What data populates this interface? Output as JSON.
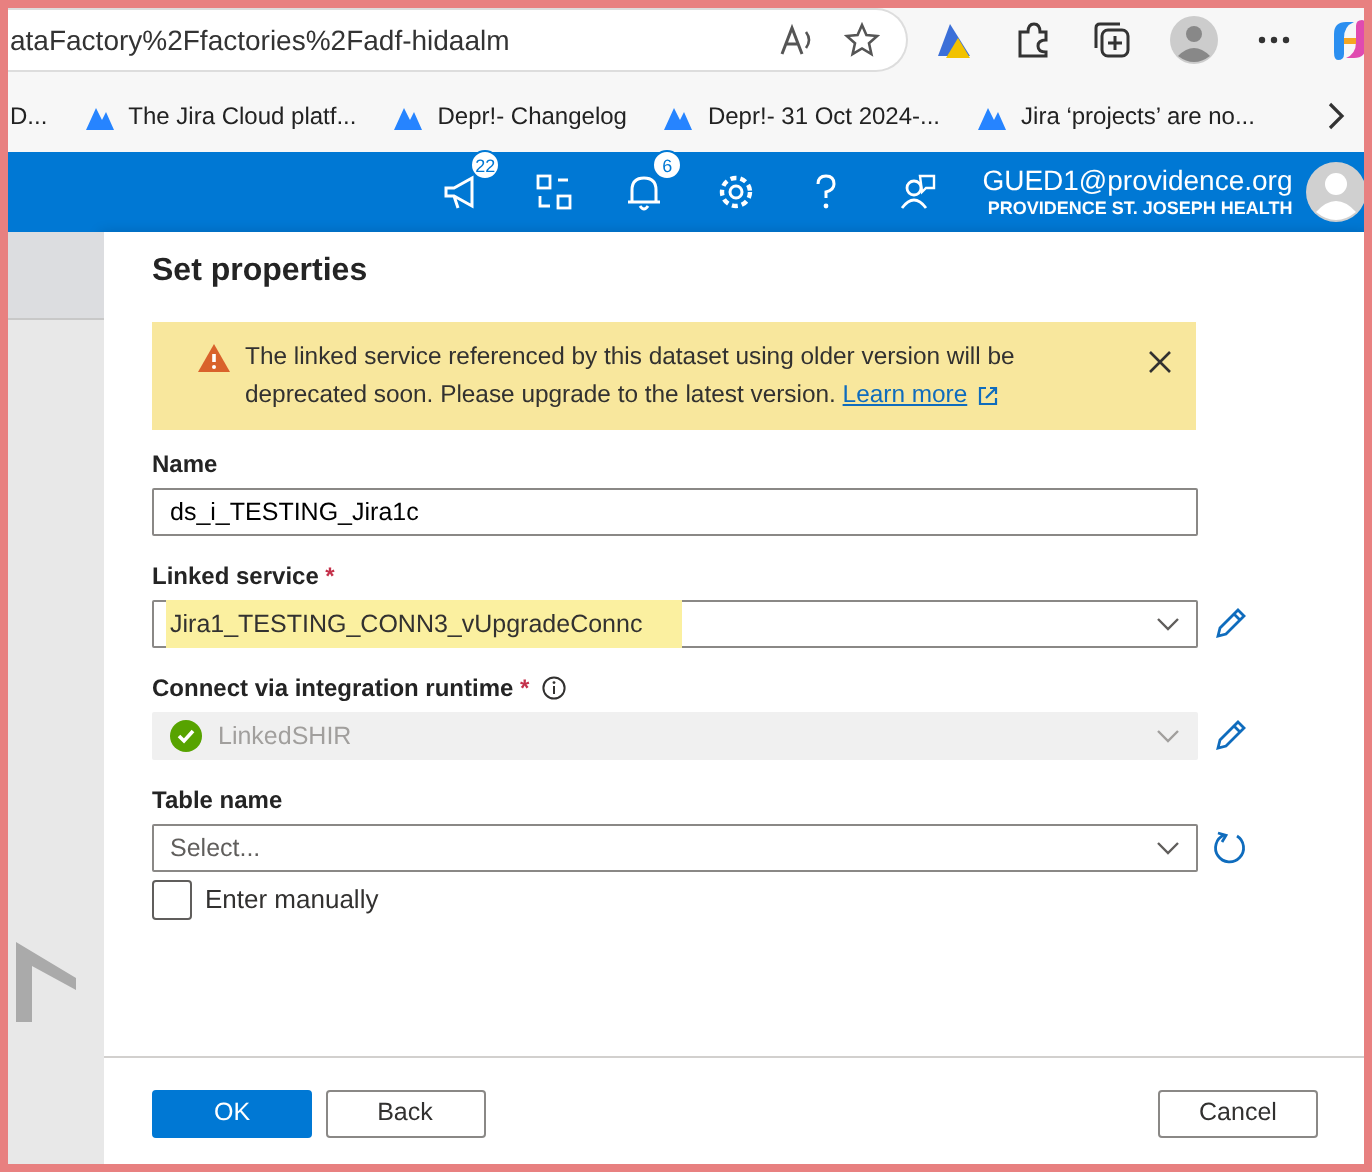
{
  "browser": {
    "address": "ataFactory%2Ffactories%2Fadf-hidaalm",
    "bookmark_cut": "D...",
    "bookmarks": [
      {
        "label": "The Jira Cloud platf..."
      },
      {
        "label": "Depr!- Changelog"
      },
      {
        "label": "Depr!- 31 Oct 2024-..."
      },
      {
        "label": "Jira ‘projects’ are no..."
      }
    ]
  },
  "header": {
    "feedback_count": "22",
    "notification_count": "6",
    "user_email": "GUED1@providence.org",
    "user_org": "PROVIDENCE ST. JOSEPH HEALTH"
  },
  "dialog": {
    "title": "Set properties",
    "alert": {
      "message": "The linked service referenced by this dataset using older version will be deprecated soon. Please upgrade to the latest version.",
      "link": "Learn more"
    },
    "fields": [
      {
        "kind": "text",
        "label": "Name",
        "value": "ds_i_TESTING_Jira1c"
      },
      {
        "kind": "select",
        "label": "Linked service",
        "required_mark": "*",
        "value": "Jira1_TESTING_CONN3_vUpgradeConnc",
        "highlighted": true,
        "editable": true
      },
      {
        "kind": "select",
        "label": "Connect via integration runtime",
        "required_mark": "*",
        "info": true,
        "value": "LinkedSHIR",
        "connected": true,
        "disabled": true,
        "editable": true
      },
      {
        "kind": "select",
        "label": "Table name",
        "placeholder": "Select...",
        "refreshable": true
      }
    ],
    "checkbox": {
      "label": "Enter manually",
      "checked": false
    },
    "buttons": [
      {
        "label": "OK",
        "primary": true
      },
      {
        "label": "Back",
        "primary": false
      },
      {
        "label": "Cancel",
        "primary": false
      }
    ]
  }
}
